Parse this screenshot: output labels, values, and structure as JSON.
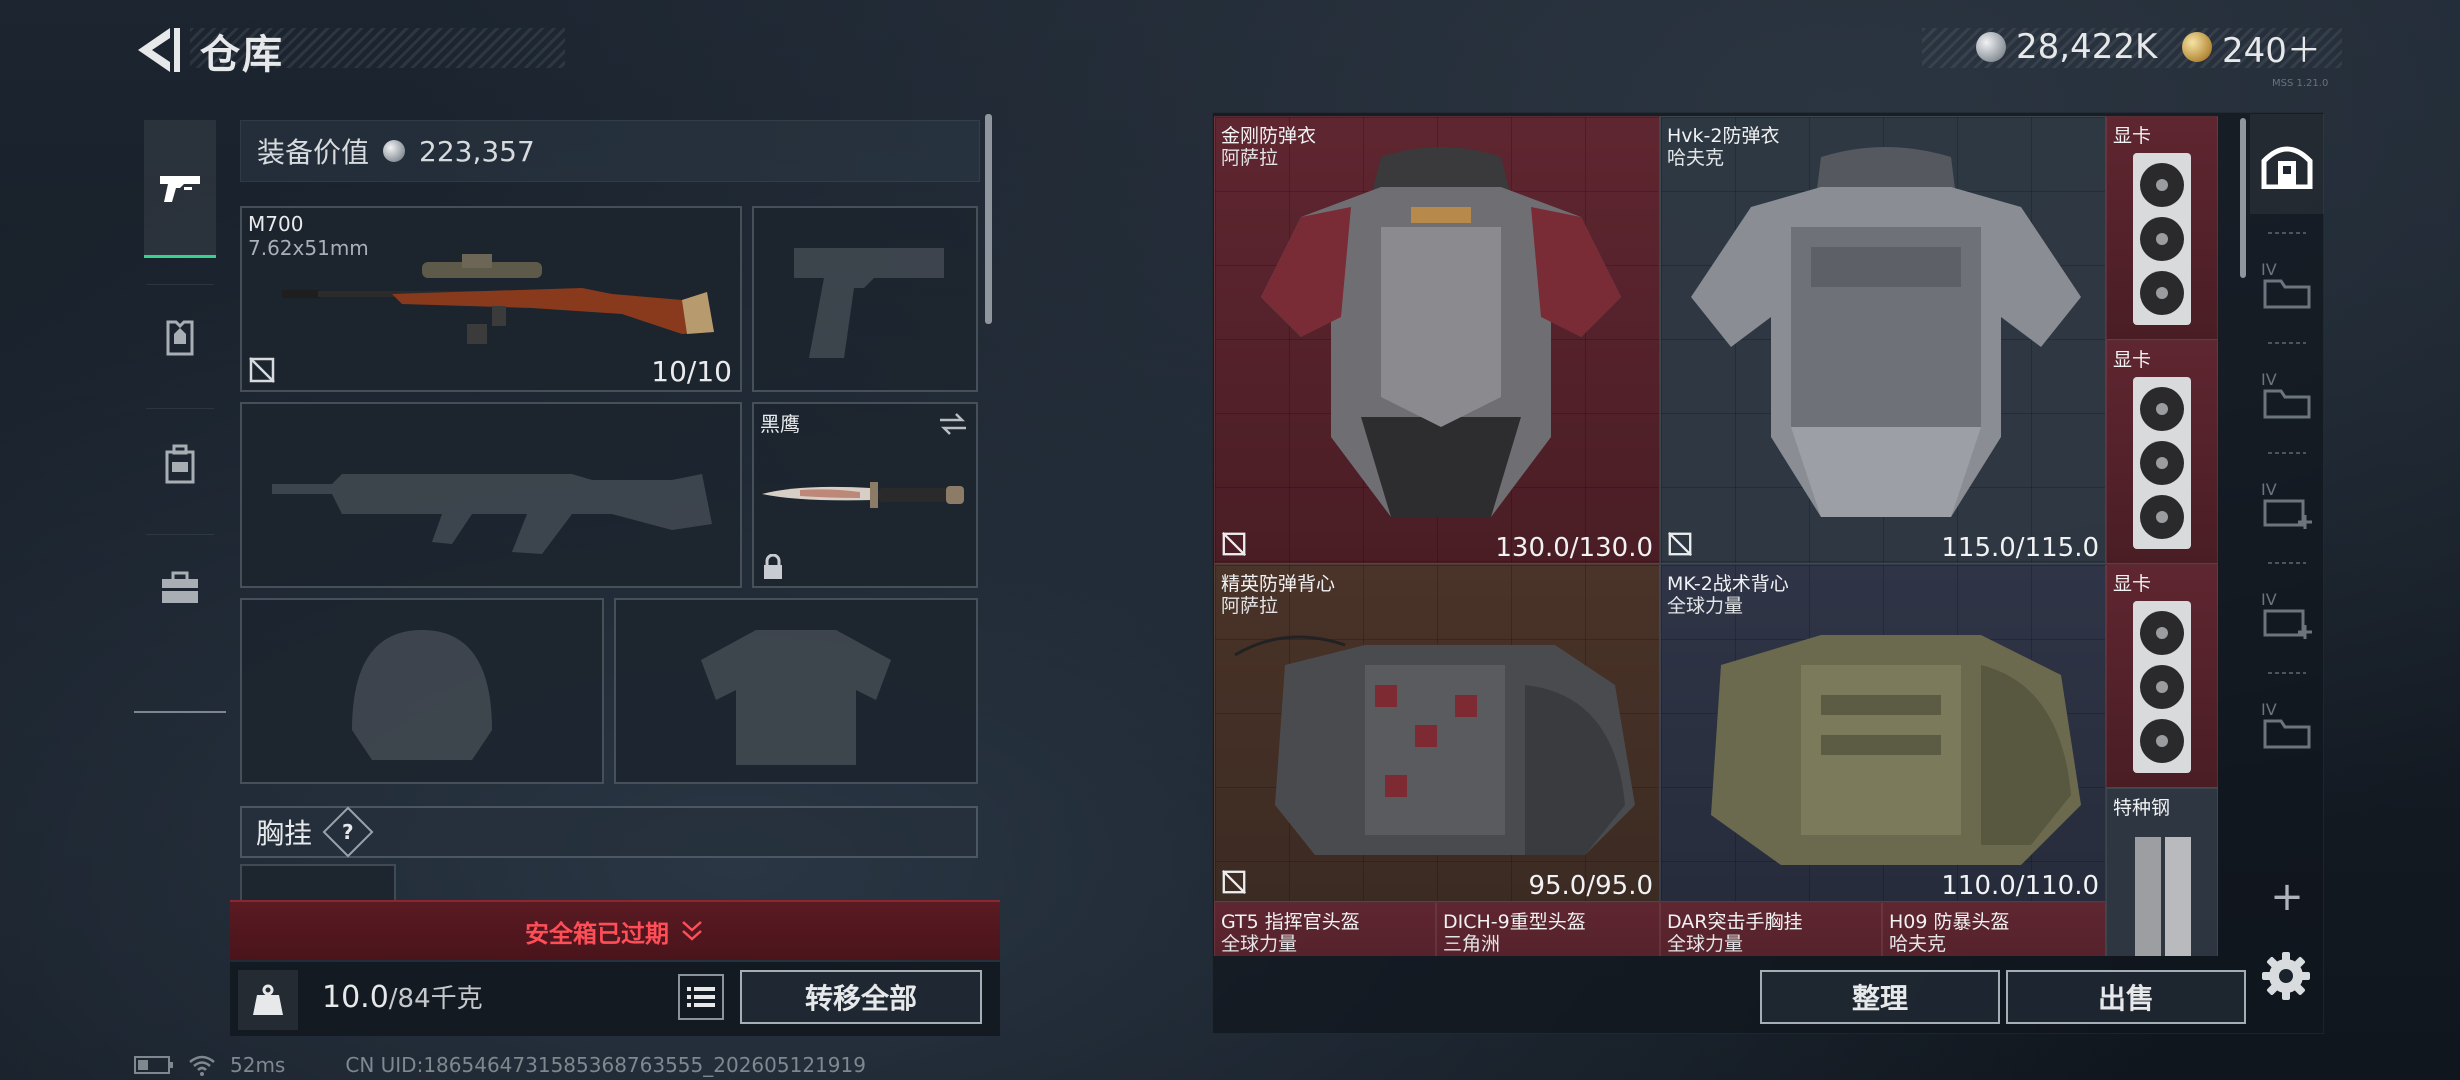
{
  "header": {
    "title": "仓库",
    "silver_amount": "28,422K",
    "gold_amount": "240＋",
    "version_tag": "MSS 1.21.0"
  },
  "left_tabs": [
    {
      "name": "weapons"
    },
    {
      "name": "armor"
    },
    {
      "name": "backpack"
    },
    {
      "name": "toolbox"
    }
  ],
  "equipment": {
    "value_label": "装备价值",
    "value_amount": "223,357",
    "primary_weapon": {
      "name": "M700",
      "caliber": "7.62x51mm",
      "ammo": "10/10"
    },
    "melee": {
      "name": "黑鹰"
    },
    "chest_rig_label": "胸挂",
    "help_glyph": "?",
    "safe_box_status": "安全箱已过期",
    "weight_current": "10.0",
    "weight_capacity": "/84千克",
    "transfer_all": "转移全部"
  },
  "storage": {
    "items": [
      {
        "name": "金刚防弹衣",
        "maker": "阿萨拉",
        "durability": "130.0/130.0"
      },
      {
        "name": "Hvk-2防弹衣",
        "maker": "哈夫克",
        "durability": "115.0/115.0"
      },
      {
        "name": "显卡"
      },
      {
        "name": "显卡"
      },
      {
        "name": "精英防弹背心",
        "maker": "阿萨拉",
        "durability": "95.0/95.0"
      },
      {
        "name": "MK-2战术背心",
        "maker": "全球力量",
        "durability": "110.0/110.0"
      },
      {
        "name": "显卡"
      },
      {
        "name": "特种钢"
      },
      {
        "name": "GT5 指挥官头盔",
        "maker": "全球力量"
      },
      {
        "name": "DICH-9重型头盔",
        "maker": "三角洲"
      },
      {
        "name": "DAR突击手胸挂",
        "maker": "全球力量"
      },
      {
        "name": "H09 防暴头盔",
        "maker": "哈夫克"
      }
    ],
    "tidy_label": "整理",
    "sell_label": "出售"
  },
  "right_sidebar": {
    "items": [
      {
        "tier": "",
        "icon": "home-storage-icon"
      },
      {
        "tier": "IV",
        "icon": "folder-icon"
      },
      {
        "tier": "IV",
        "icon": "folder-icon"
      },
      {
        "tier": "IV",
        "icon": "case-add-icon"
      },
      {
        "tier": "IV",
        "icon": "case-add-icon"
      },
      {
        "tier": "IV",
        "icon": "folder-icon"
      }
    ],
    "add_glyph": "+"
  },
  "footer": {
    "ping": "52ms",
    "uid": "CN UID:1865464731585368763555_202605121919"
  },
  "colors": {
    "accent_green": "#38d28f",
    "warning_red": "#ff4e57",
    "item_red_bg": "#5f2630"
  }
}
